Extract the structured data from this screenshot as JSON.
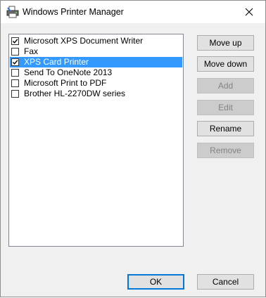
{
  "window": {
    "title": "Windows Printer Manager",
    "icon": "printer-icon",
    "close_icon": "close-icon"
  },
  "printers": [
    {
      "label": "Microsoft XPS Document Writer",
      "checked": true,
      "selected": false
    },
    {
      "label": "Fax",
      "checked": false,
      "selected": false
    },
    {
      "label": "XPS Card Printer",
      "checked": true,
      "selected": true
    },
    {
      "label": "Send To OneNote 2013",
      "checked": false,
      "selected": false
    },
    {
      "label": "Microsoft Print to PDF",
      "checked": false,
      "selected": false
    },
    {
      "label": "Brother HL-2270DW series",
      "checked": false,
      "selected": false
    }
  ],
  "actions": {
    "move_up": "Move up",
    "move_down": "Move down",
    "add": "Add",
    "edit": "Edit",
    "rename": "Rename",
    "remove": "Remove"
  },
  "footer": {
    "ok": "OK",
    "cancel": "Cancel"
  },
  "colors": {
    "selection": "#3399ff",
    "default_button_border": "#0078d7",
    "disabled_text": "#838383"
  }
}
